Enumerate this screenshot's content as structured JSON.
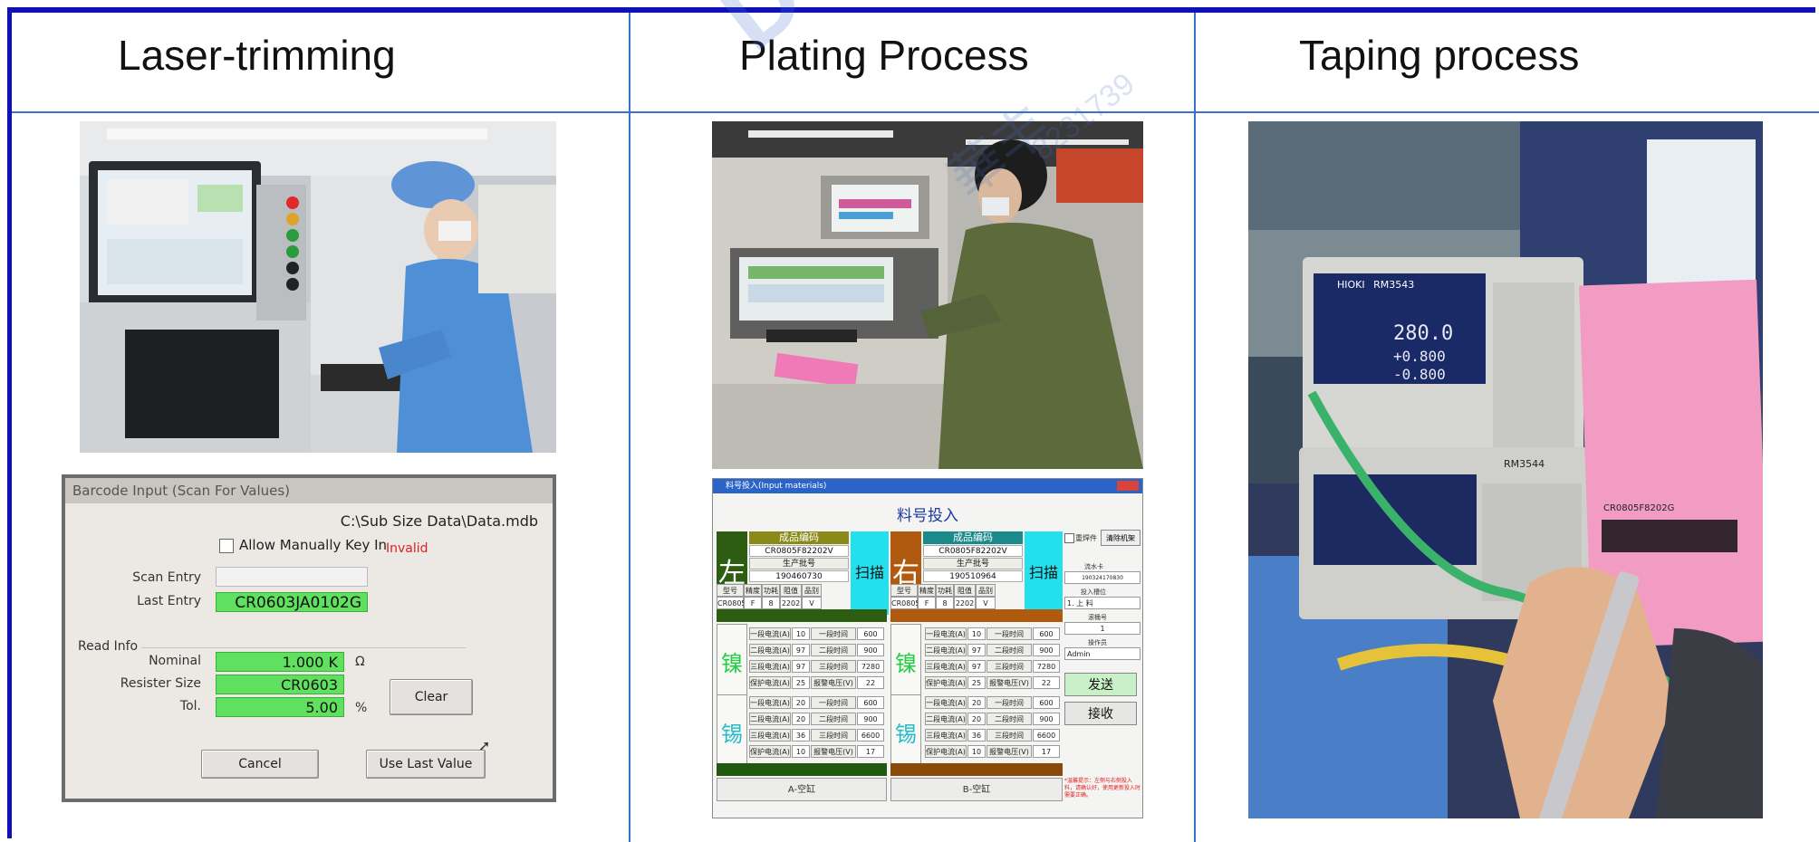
{
  "headings": {
    "col1": "Laser-trimming",
    "col2": "Plating Process",
    "col3": "Taping process"
  },
  "watermark": {
    "text": "DGPHI",
    "chinese": "華丰",
    "number": "8231739"
  },
  "barcode_dialog": {
    "title": "Barcode Input (Scan For Values)",
    "db_path": "C:\\Sub Size Data\\Data.mdb",
    "allow_manual_label": "Allow Manually Key In",
    "invalid_text": "Invalid",
    "scan_entry_label": "Scan Entry",
    "scan_entry_value": "",
    "last_entry_label": "Last Entry",
    "last_entry_value": "CR0603JA0102G",
    "read_info_label": "Read Info",
    "nominal_label": "Nominal",
    "nominal_value": "1.000 K",
    "nominal_unit": "Ω",
    "resister_size_label": "Resister Size",
    "resister_size_value": "CR0603",
    "tol_label": "Tol.",
    "tol_value": "5.00",
    "tol_unit": "%",
    "clear_button": "Clear",
    "cancel_button": "Cancel",
    "use_last_button": "Use Last Value"
  },
  "input_materials": {
    "title": "料号投入(Input materials)",
    "heading": "料号投入",
    "left": {
      "side": "左",
      "code_title": "成品编码",
      "code_value": "CR0805F82202V",
      "batch_title": "生产批号",
      "batch_value": "190460730",
      "scan": "扫描",
      "spec_headers": [
        "型号",
        "精度",
        "功耗",
        "阻值",
        "品别"
      ],
      "spec_values": [
        "CR0805",
        "F",
        "8",
        "2202",
        "V"
      ]
    },
    "right": {
      "side": "右",
      "code_title": "成品编码",
      "code_value": "CR0805F82202V",
      "batch_title": "生产批号",
      "batch_value": "190510964",
      "scan": "扫描",
      "spec_headers": [
        "型号",
        "精度",
        "功耗",
        "阻值",
        "品别"
      ],
      "spec_values": [
        "CR0805",
        "F",
        "8",
        "2202",
        "V"
      ]
    },
    "nickel": "镍",
    "tin": "锡",
    "left_nickel_rows": [
      [
        "一段电流(A)",
        "10",
        "一段时间(Sec)",
        "600"
      ],
      [
        "二段电流(A)",
        "97",
        "二段时间(Sec)",
        "900"
      ],
      [
        "三段电流(A)",
        "97",
        "三段时间(Sec)",
        "7280"
      ],
      [
        "保护电流(A)",
        "25",
        "报警电压(V)",
        "22"
      ]
    ],
    "left_tin_rows": [
      [
        "一段电流(A)",
        "20",
        "一段时间(Sec)",
        "600"
      ],
      [
        "二段电流(A)",
        "20",
        "二段时间(Sec)",
        "900"
      ],
      [
        "三段电流(A)",
        "36",
        "三段时间(Sec)",
        "6600"
      ],
      [
        "保护电流(A)",
        "10",
        "报警电压(V)",
        "17"
      ]
    ],
    "right_nickel_rows": [
      [
        "一段电流(A)",
        "10",
        "一段时间(Sec)",
        "600"
      ],
      [
        "二段电流(A)",
        "97",
        "二段时间(Sec)",
        "900"
      ],
      [
        "三段电流(A)",
        "97",
        "三段时间(Sec)",
        "7280"
      ],
      [
        "保护电流(A)",
        "25",
        "报警电压(V)",
        "22"
      ]
    ],
    "right_tin_rows": [
      [
        "一段电流(A)",
        "20",
        "一段时间(Sec)",
        "600"
      ],
      [
        "二段电流(A)",
        "20",
        "二段时间(Sec)",
        "900"
      ],
      [
        "三段电流(A)",
        "36",
        "三段时间(Sec)",
        "6600"
      ],
      [
        "保护电流(A)",
        "10",
        "报警电压(V)",
        "17"
      ]
    ],
    "foot_a": "A-空缸",
    "foot_b": "B-空缸",
    "panel": {
      "checkbox_label": "重焊件",
      "clear_machine": "清除机架",
      "flow_card_label": "流水卡",
      "flow_card_value": "190324170830",
      "position_label": "投入槽位",
      "position_value": "1. 上 料",
      "count_label": "滚桶号",
      "count_value": "1",
      "operator_label": "操作员",
      "operator_value": "Admin",
      "send": "发送",
      "receive": "接收",
      "note": "*温馨提示：左侧与右侧投入料，请确认好，使用更新投入时需要正确。"
    }
  },
  "photos": {
    "laser": "operator at laser trimming machine",
    "plating": "operator at plating control terminal",
    "taping": "HIOKI RM3543 resistance meters with pink label"
  },
  "meter": {
    "brand": "HIOKI",
    "model_top": "RM3543",
    "model_bottom": "RM3544",
    "reading": "280.0",
    "hi": "+0.800",
    "lo": "-0.800"
  },
  "label_card": {
    "code": "CR0805F8202G"
  },
  "colors": {
    "frame": "#1010b8",
    "grid_line": "#3b72c8",
    "field_green": "#5fe05f",
    "scan_cyan": "#23e0ee"
  }
}
